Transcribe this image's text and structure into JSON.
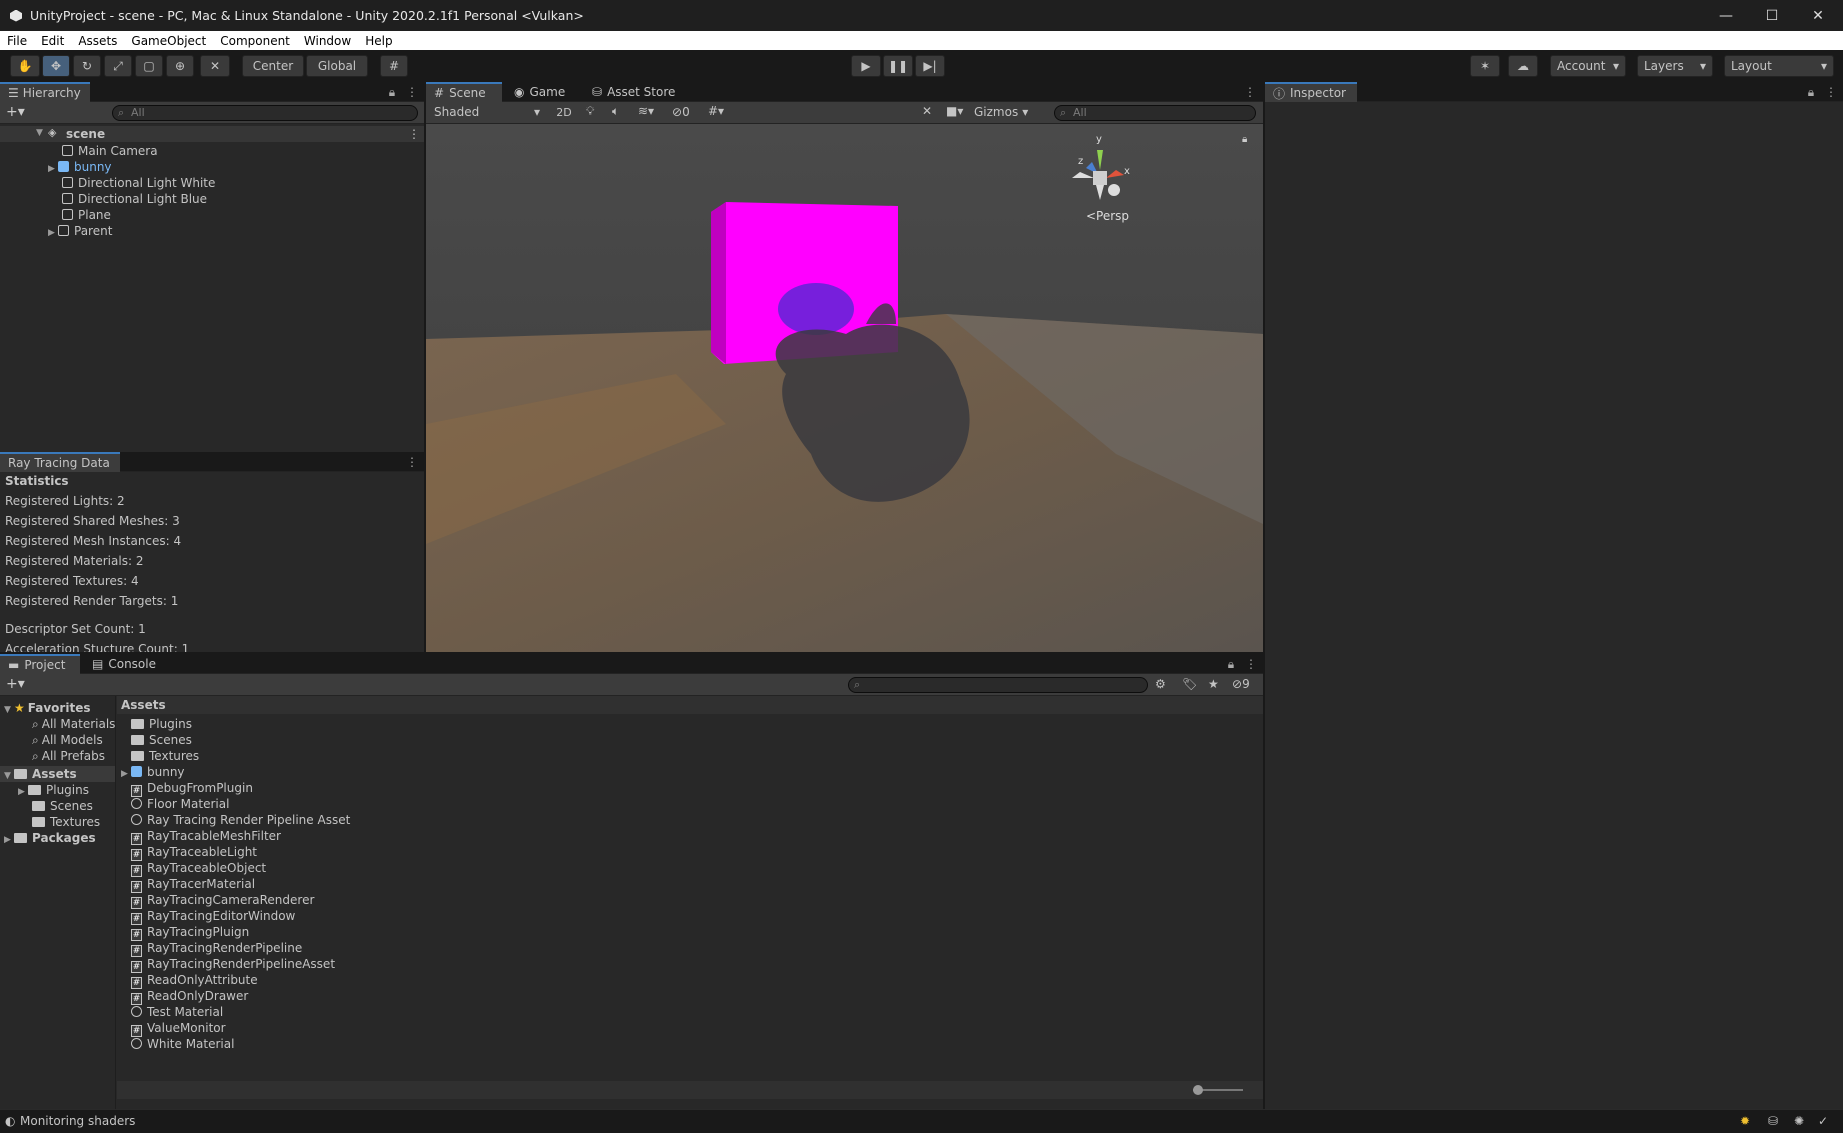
{
  "window": {
    "title": "UnityProject - scene - PC, Mac & Linux Standalone - Unity 2020.2.1f1 Personal <Vulkan>",
    "minimize": "—",
    "maximize": "☐",
    "close": "✕"
  },
  "menu": [
    "File",
    "Edit",
    "Assets",
    "GameObject",
    "Component",
    "Window",
    "Help"
  ],
  "toolbar": {
    "center": "Center",
    "global": "Global",
    "account": "Account",
    "layers": "Layers",
    "layout": "Layout"
  },
  "hierarchy": {
    "tab": "Hierarchy",
    "search_placeholder": "All",
    "scene": "scene",
    "items": [
      "Main Camera",
      "bunny",
      "Directional Light White",
      "Directional Light Blue",
      "Plane",
      "Parent"
    ]
  },
  "raytracing": {
    "tab": "Ray Tracing Data",
    "heading": "Statistics",
    "stats": [
      "Registered Lights: 2",
      "Registered Shared Meshes: 3",
      "Registered Mesh Instances: 4",
      "Registered Materials: 2",
      "Registered Textures: 4",
      "Registered Render Targets: 1"
    ],
    "extra": [
      "Descriptor Set Count: 1",
      "Acceleration Stucture Count: 1"
    ]
  },
  "scene": {
    "tabs": [
      "Scene",
      "Game",
      "Asset Store"
    ],
    "shading": "Shaded",
    "mode_2d": "2D",
    "hidden_count": "0",
    "gizmos": "Gizmos",
    "search_placeholder": "All",
    "persp": "<Persp",
    "axis_x": "x",
    "axis_y": "y",
    "axis_z": "z"
  },
  "inspector": {
    "tab": "Inspector"
  },
  "project": {
    "tabs": [
      "Project",
      "Console"
    ],
    "hidden_count": "9",
    "favorites": "Favorites",
    "fav_items": [
      "All Materials",
      "All Models",
      "All Prefabs"
    ],
    "assets_root": "Assets",
    "asset_folders": [
      "Plugins",
      "Scenes",
      "Textures"
    ],
    "packages": "Packages",
    "breadcrumb": "Assets",
    "files": [
      {
        "name": "Plugins",
        "kind": "folder"
      },
      {
        "name": "Scenes",
        "kind": "folder"
      },
      {
        "name": "Textures",
        "kind": "folder"
      },
      {
        "name": "bunny",
        "kind": "model"
      },
      {
        "name": "DebugFromPlugin",
        "kind": "script"
      },
      {
        "name": "Floor Material",
        "kind": "material"
      },
      {
        "name": "Ray Tracing Render Pipeline Asset",
        "kind": "material"
      },
      {
        "name": "RayTracableMeshFilter",
        "kind": "script"
      },
      {
        "name": "RayTraceableLight",
        "kind": "script"
      },
      {
        "name": "RayTraceableObject",
        "kind": "script"
      },
      {
        "name": "RayTracerMaterial",
        "kind": "script"
      },
      {
        "name": "RayTracingCameraRenderer",
        "kind": "script"
      },
      {
        "name": "RayTracingEditorWindow",
        "kind": "script"
      },
      {
        "name": "RayTracingPluign",
        "kind": "script"
      },
      {
        "name": "RayTracingRenderPipeline",
        "kind": "script"
      },
      {
        "name": "RayTracingRenderPipelineAsset",
        "kind": "script"
      },
      {
        "name": "ReadOnlyAttribute",
        "kind": "script"
      },
      {
        "name": "ReadOnlyDrawer",
        "kind": "script"
      },
      {
        "name": "Test Material",
        "kind": "material"
      },
      {
        "name": "ValueMonitor",
        "kind": "script"
      },
      {
        "name": "White Material",
        "kind": "material"
      }
    ]
  },
  "status": {
    "text": "Monitoring shaders"
  },
  "colors": {
    "accent": "#3a79bb",
    "cube": "#ff00ff",
    "bunny_link": "#7ab8f5"
  }
}
